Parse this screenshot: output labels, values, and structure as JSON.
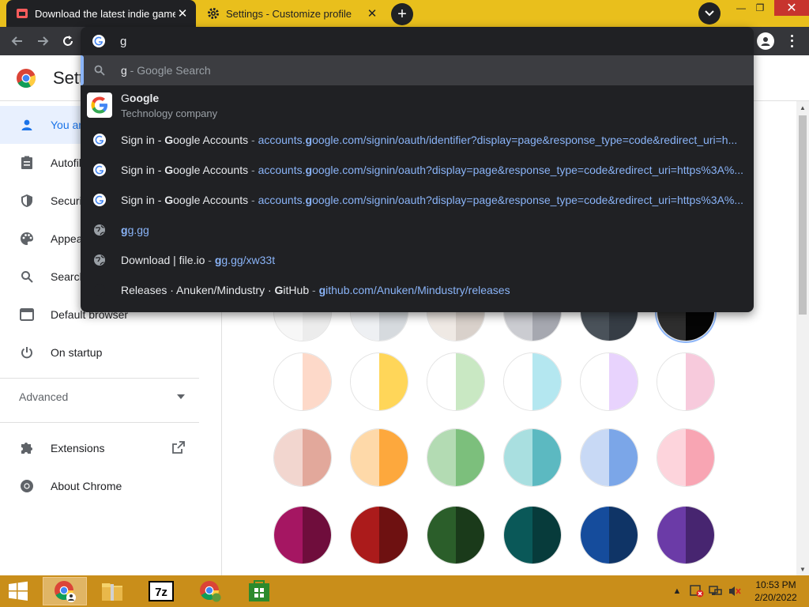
{
  "tabs": [
    {
      "title": "Download the latest indie games",
      "icon": "itch-io-icon"
    },
    {
      "title": "Settings - Customize profile",
      "icon": "gear-icon"
    }
  ],
  "omnibox": {
    "query": "g",
    "search_suggestion": {
      "query": "g",
      "sep": " - ",
      "label": "Google Search"
    },
    "entity": {
      "name_match": "G",
      "name_rest": "oogle",
      "description": "Technology company"
    },
    "suggestions": [
      {
        "icon": "google-icon",
        "pre": "Sign in - ",
        "match": "G",
        "rest": "oogle Accounts",
        "sep": " - ",
        "url_pre": "accounts.",
        "url_match": "g",
        "url_rest": "oogle.com/signin/oauth/identifier?display=page&response_type=code&redirect_uri=h..."
      },
      {
        "icon": "google-icon",
        "pre": "Sign in - ",
        "match": "G",
        "rest": "oogle Accounts",
        "sep": " - ",
        "url_pre": "accounts.",
        "url_match": "g",
        "url_rest": "oogle.com/signin/oauth?display=page&response_type=code&redirect_uri=https%3A%..."
      },
      {
        "icon": "google-icon",
        "pre": "Sign in - ",
        "match": "G",
        "rest": "oogle Accounts",
        "sep": " - ",
        "url_pre": "accounts.",
        "url_match": "g",
        "url_rest": "oogle.com/signin/oauth?display=page&response_type=code&redirect_uri=https%3A%..."
      },
      {
        "icon": "globe-icon",
        "pre": "",
        "match": "",
        "rest": "",
        "sep": "",
        "url_pre": "",
        "url_match": "g",
        "url_rest": "g.gg"
      },
      {
        "icon": "globe-icon",
        "pre": "Download | file.io",
        "match": "",
        "rest": "",
        "sep": " - ",
        "url_pre": "",
        "url_match": "g",
        "url_rest": "g.gg/xw33t"
      },
      {
        "icon": "github-icon",
        "pre": "Releases · Anuken/Mindustry · ",
        "match": "G",
        "rest": "itHub",
        "sep": " - ",
        "url_pre": "",
        "url_match": "g",
        "url_rest": "ithub.com/Anuken/Mindustry/releases"
      }
    ]
  },
  "settings": {
    "title": "Settings",
    "sidebar": [
      {
        "label": "You and Google",
        "icon": "person-icon",
        "selected": true
      },
      {
        "label": "Autofill",
        "icon": "clipboard-icon"
      },
      {
        "label": "Security and privacy",
        "icon": "shield-icon"
      },
      {
        "label": "Appearance",
        "icon": "palette-icon"
      },
      {
        "label": "Search engine",
        "icon": "search-icon"
      },
      {
        "label": "Default browser",
        "icon": "browser-icon"
      },
      {
        "label": "On startup",
        "icon": "power-icon"
      }
    ],
    "advanced_label": "Advanced",
    "extensions_label": "Extensions",
    "about_label": "About Chrome"
  },
  "swatch_rows": [
    [
      [
        "#f7f7f7",
        "#ececec"
      ],
      [
        "#eef0f3",
        "#d6dade"
      ],
      [
        "#efe9e4",
        "#d9d1cb"
      ],
      [
        "#cbccd1",
        "#a6a8b0"
      ],
      [
        "#4a525a",
        "#363d45"
      ],
      [
        "#2e2e2e",
        "#050505"
      ]
    ],
    [
      [
        "#ffffff",
        "#fdd9c9"
      ],
      [
        "#ffffff",
        "#ffd659"
      ],
      [
        "#ffffff",
        "#c9e8c3"
      ],
      [
        "#ffffff",
        "#b4e7f0"
      ],
      [
        "#ffffff",
        "#e8d3fd"
      ],
      [
        "#ffffff",
        "#f7cadc"
      ]
    ],
    [
      [
        "#f2d6cf",
        "#e2a89b"
      ],
      [
        "#fed9a9",
        "#fda83d"
      ],
      [
        "#b3dbb3",
        "#7cbf7c"
      ],
      [
        "#a9dfe0",
        "#5cb9c1"
      ],
      [
        "#c8d9f5",
        "#7ba6e8"
      ],
      [
        "#fdd4dc",
        "#f8a5b3"
      ]
    ],
    [
      [
        "#a51662",
        "#6f0d3c"
      ],
      [
        "#ab1b1b",
        "#6e1111"
      ],
      [
        "#2b5e2a",
        "#1a3a1a"
      ],
      [
        "#0a5858",
        "#073b3b"
      ],
      [
        "#154c9c",
        "#0f3466"
      ],
      [
        "#6b3ba7",
        "#472570"
      ]
    ]
  ],
  "clock": {
    "time": "10:53 PM",
    "date": "2/20/2022"
  }
}
